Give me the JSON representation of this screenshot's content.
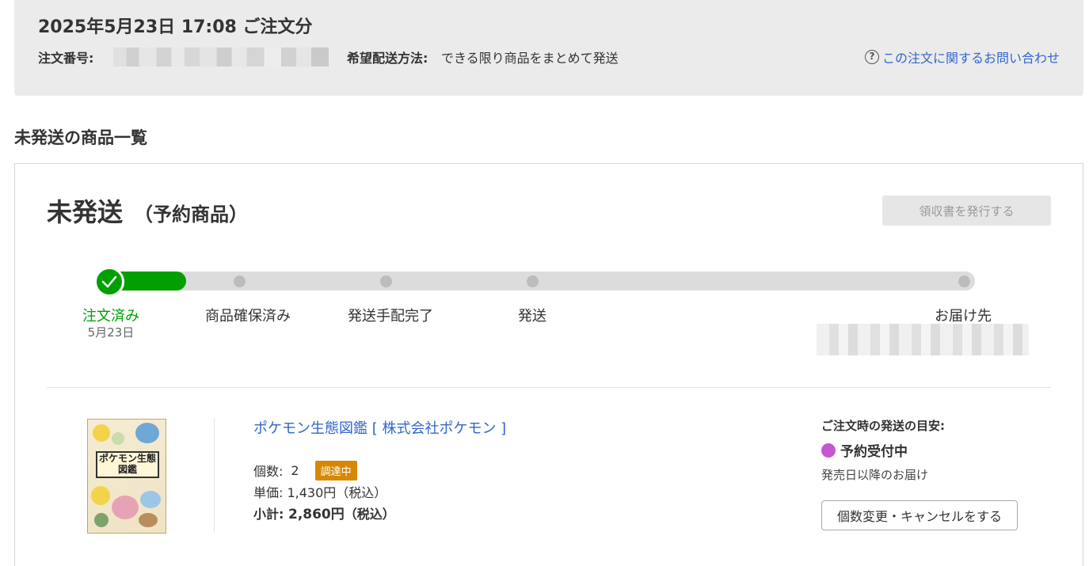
{
  "order": {
    "title": "2025年5月23日 17:08 ご注文分",
    "number_label": "注文番号:",
    "shipping_label": "希望配送方法:",
    "shipping_value": "できる限り商品をまとめて発送",
    "inquiry_link": "この注文に関するお問い合わせ",
    "inquiry_icon": "?"
  },
  "section": {
    "title": "未発送の商品一覧"
  },
  "status": {
    "main": "未発送",
    "sub": "（予約商品）",
    "receipt_button": "領収書を発行する"
  },
  "progress": {
    "current_step": 0,
    "steps": [
      {
        "label": "注文済み",
        "date": "5月23日",
        "done": true
      },
      {
        "label": "商品確保済み",
        "done": false
      },
      {
        "label": "発送手配完了",
        "done": false
      },
      {
        "label": "発送",
        "done": false
      },
      {
        "label": "お届け先",
        "done": false
      }
    ]
  },
  "item": {
    "cover_text": "ポケモン生態図鑑",
    "title": "ポケモン生態図鑑 [ 株式会社ポケモン ]",
    "qty_label": "個数:",
    "qty_value": "2",
    "badge": "調達中",
    "unit_price": "単価: 1,430円（税込）",
    "subtotal_label": "小計:",
    "subtotal_value": "2,860円",
    "subtotal_tax": "（税込）"
  },
  "shipping_guide": {
    "label": "ご注文時の発送の目安:",
    "status": "予約受付中",
    "status_color": "#c557d2",
    "note": "発売日以降のお届け",
    "cancel_button": "個数変更・キャンセルをする"
  },
  "colors": {
    "accent_green": "#00a000",
    "link_blue": "#3366cc",
    "badge_orange": "#d88800"
  }
}
